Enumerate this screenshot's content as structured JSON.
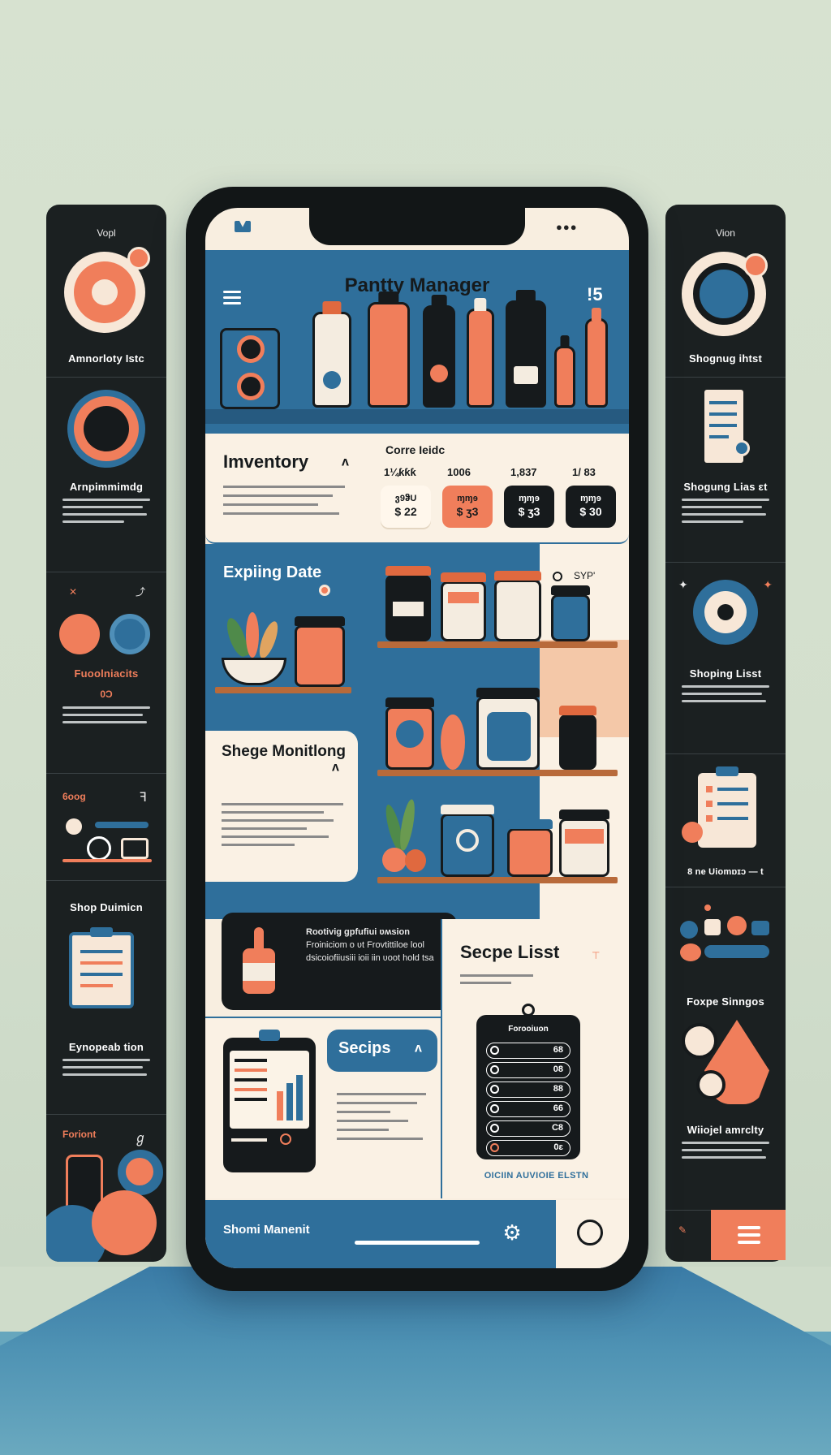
{
  "app": {
    "title": "Pantty Manager",
    "hero_right": "!5"
  },
  "inventory": {
    "title": "Imventory",
    "cols_head": "Corre Ieidc",
    "col_values": [
      "1¼ƙƙƙ",
      "1006",
      "1,837",
      "1/ 83"
    ],
    "pills": [
      {
        "top": "ვ9ჵU",
        "bottom": "$ 22"
      },
      {
        "top": "ɱɱɘ",
        "bottom": "$ ʒ3"
      },
      {
        "top": "ɱɱɘ",
        "bottom": "$ ʒ3"
      },
      {
        "top": "ɱɱɘ",
        "bottom": "$ 30"
      }
    ]
  },
  "expiring": {
    "title": "Expiing Date",
    "note": "SYP'"
  },
  "storage": {
    "title": "Shege Monitlong"
  },
  "tip": {
    "title": "Rootivig gpfufiui ʋʍsion",
    "text": "Froiniciom o ʋt Frovtittiloe lool dsicoiofiiusiii ioii iin ʋoot hold tsa"
  },
  "recipe_list": {
    "title": "Secpe Lisst",
    "board_head": "Forooiuon",
    "rows": [
      "68",
      "08",
      "88",
      "66",
      "C8",
      "0ɛ"
    ],
    "footer": "OICIIN AUVIOIE ELSTN"
  },
  "recipes": {
    "title": "Secips"
  },
  "bottom": {
    "title": "Shomi Manenit"
  },
  "left_panel": {
    "top_tag": "Vopl",
    "s1_title": "Amnorloty Istc",
    "s2_title": "Arnpimmimdg",
    "s3_title": "Fuoolniacits",
    "s3_sub": "0Ɔ",
    "s4_tag": "6oog",
    "s4_icon": "ꟻ",
    "s5_title": "Shop Duimicn",
    "s6_title": "Eynopeab tion",
    "s7_tag": "Foriont",
    "s7_icon": "ℊ"
  },
  "right_panel": {
    "top_tag": "Vion",
    "s1_title": "Shognug ihtst",
    "s2_title": "Shogung Lias ɛt",
    "s3_title": "Shoping Lisst",
    "s4_title": "8 ne Uiomɒɪɔ — t",
    "s5_title": "Foxpe Sinngos",
    "s6_title": "Wiiojel amrclty"
  },
  "colors": {
    "blue": "#2f6f9b",
    "orange": "#f07e5b",
    "cream": "#faf1e4",
    "dark": "#161a1c"
  },
  "icons": [
    "menu-icon",
    "gear-icon",
    "profile-icon",
    "chevron-up-icon",
    "sparkle-icon"
  ]
}
